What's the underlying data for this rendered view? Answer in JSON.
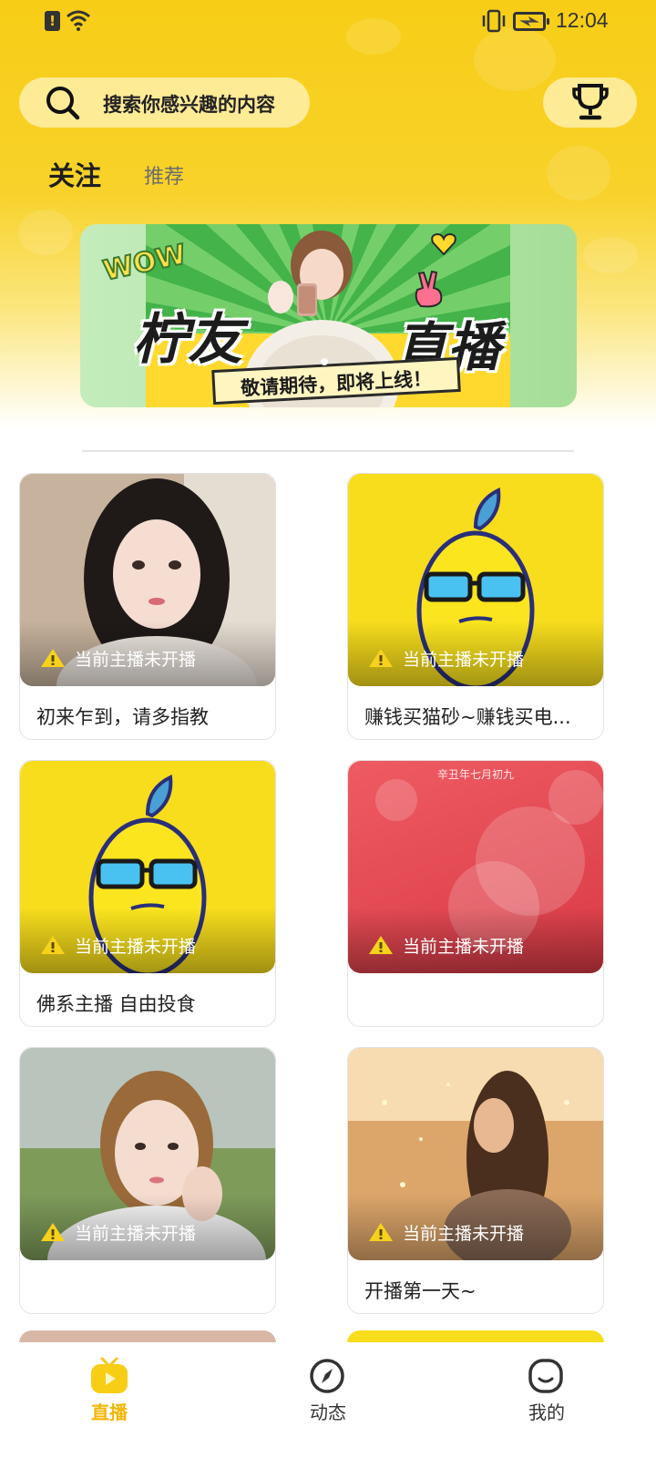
{
  "status_bar": {
    "time": "12:04",
    "icons": [
      "alert-icon",
      "wifi-icon",
      "vibrate-icon",
      "battery-charging-icon"
    ]
  },
  "header": {
    "search_placeholder": "搜索你感兴趣的内容",
    "search_icon": "search-icon",
    "trophy_icon": "trophy-icon"
  },
  "tabs": [
    {
      "label": "关注",
      "active": true
    },
    {
      "label": "推荐",
      "active": false
    }
  ],
  "banner": {
    "wow": "WOW",
    "left_text": "柠友",
    "right_text": "直播",
    "ribbon": "敬请期待，即将上线！"
  },
  "cards": [
    {
      "status": "当前主播未开播",
      "title": "初来乍到，请多指教",
      "thumb": "photo"
    },
    {
      "status": "当前主播未开播",
      "title": "赚钱买猫砂~赚钱买电...",
      "thumb": "lemon-mascot"
    },
    {
      "status": "当前主播未开播",
      "title": "佛系主播 自由投食",
      "thumb": "lemon-mascot"
    },
    {
      "status": "当前主播未开播",
      "title": "",
      "thumb": "red-calendar",
      "thumb_text": "辛丑年七月初九"
    },
    {
      "status": "当前主播未开播",
      "title": "",
      "thumb": "photo"
    },
    {
      "status": "当前主播未开播",
      "title": "开播第一天~",
      "thumb": "photo"
    }
  ],
  "colors": {
    "accent": "#f7cd16",
    "nav_active": "#f2b705",
    "lemon_bg": "#f7dd1c"
  },
  "bottom_nav": [
    {
      "label": "直播",
      "icon": "live-tv-icon",
      "active": true
    },
    {
      "label": "动态",
      "icon": "compass-icon",
      "active": false
    },
    {
      "label": "我的",
      "icon": "smiley-profile-icon",
      "active": false
    }
  ]
}
